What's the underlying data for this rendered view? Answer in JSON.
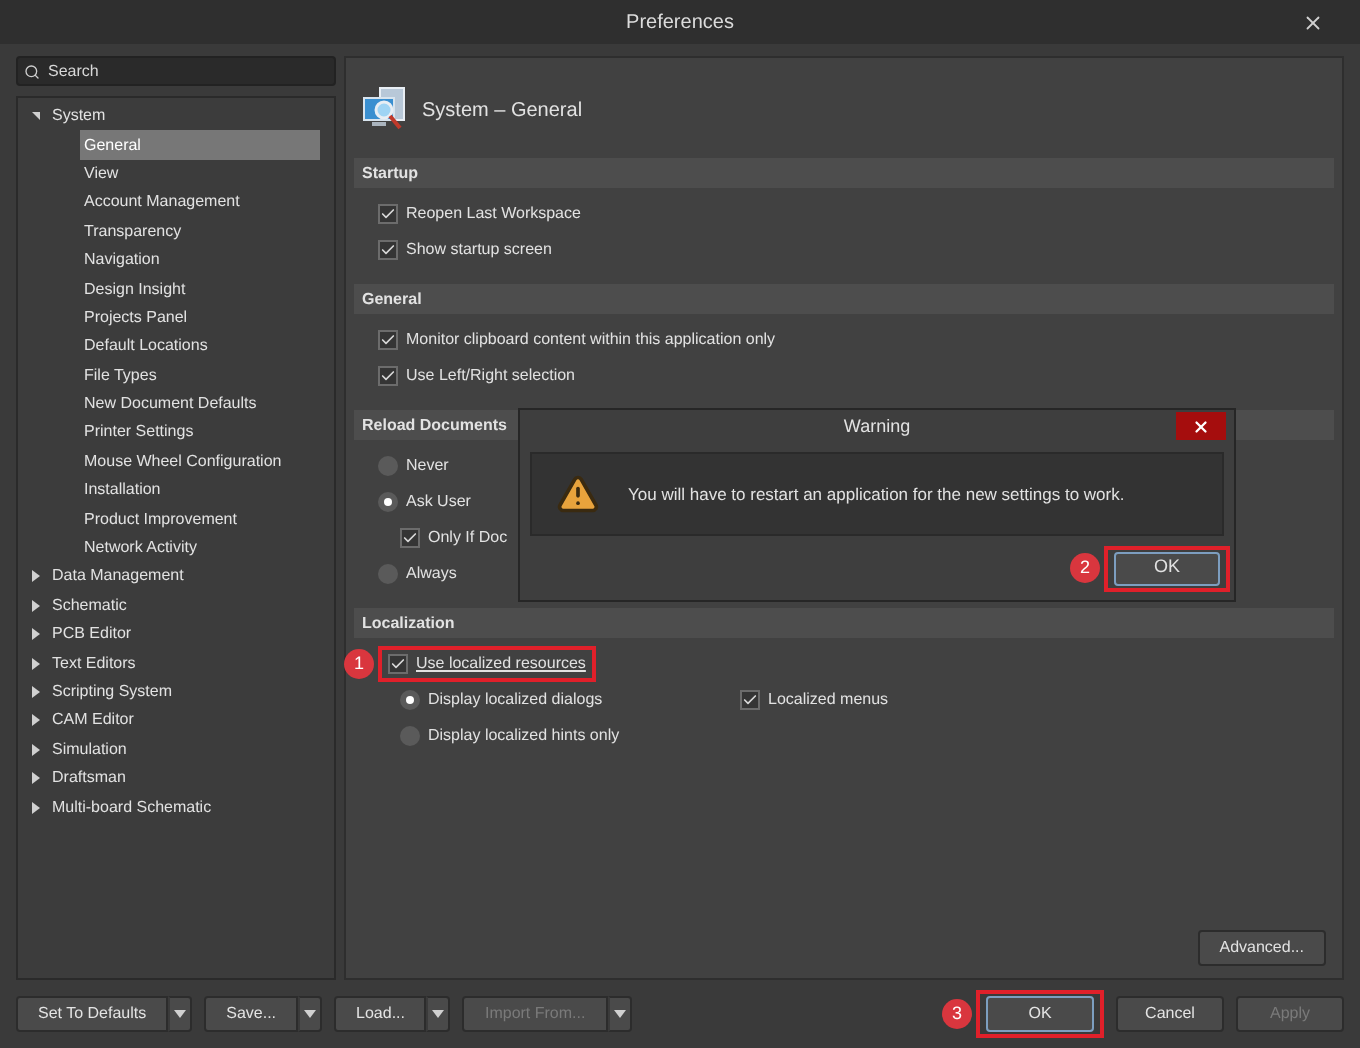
{
  "window": {
    "title": "Preferences"
  },
  "search": {
    "placeholder": "Search"
  },
  "tree": [
    {
      "label": "System",
      "expanded": true,
      "children": [
        {
          "label": "General",
          "selected": true
        },
        {
          "label": "View",
          "selected": false
        },
        {
          "label": "Account Management",
          "selected": false
        },
        {
          "label": "Transparency",
          "selected": false
        },
        {
          "label": "Navigation",
          "selected": false
        },
        {
          "label": "Design Insight",
          "selected": false
        },
        {
          "label": "Projects Panel",
          "selected": false
        },
        {
          "label": "Default Locations",
          "selected": false
        },
        {
          "label": "File Types",
          "selected": false
        },
        {
          "label": "New Document Defaults",
          "selected": false
        },
        {
          "label": "Printer Settings",
          "selected": false
        },
        {
          "label": "Mouse Wheel Configuration",
          "selected": false
        },
        {
          "label": "Installation",
          "selected": false
        },
        {
          "label": "Product Improvement",
          "selected": false
        },
        {
          "label": "Network Activity",
          "selected": false
        }
      ]
    },
    {
      "label": "Data Management",
      "expanded": false
    },
    {
      "label": "Schematic",
      "expanded": false
    },
    {
      "label": "PCB Editor",
      "expanded": false
    },
    {
      "label": "Text Editors",
      "expanded": false
    },
    {
      "label": "Scripting System",
      "expanded": false
    },
    {
      "label": "CAM Editor",
      "expanded": false
    },
    {
      "label": "Simulation",
      "expanded": false
    },
    {
      "label": "Draftsman",
      "expanded": false
    },
    {
      "label": "Multi-board Schematic",
      "expanded": false
    }
  ],
  "page": {
    "title": "System – General",
    "sections": [
      {
        "title": "Startup",
        "options": [
          {
            "kind": "checkbox",
            "label": "Reopen Last Workspace",
            "checked": true
          },
          {
            "kind": "checkbox",
            "label": "Show startup screen",
            "checked": true
          }
        ]
      },
      {
        "title": "General",
        "options": [
          {
            "kind": "checkbox",
            "label": "Monitor clipboard content within this application only",
            "checked": true
          },
          {
            "kind": "checkbox",
            "label": "Use Left/Right selection",
            "checked": true
          }
        ]
      },
      {
        "title": "Reload Documents",
        "options": [
          {
            "kind": "radio",
            "label": "Never",
            "selected": false
          },
          {
            "kind": "radio",
            "label": "Ask User",
            "selected": true,
            "children": [
              {
                "kind": "checkbox",
                "label": "Only If Doc",
                "checked": true
              }
            ]
          },
          {
            "kind": "radio",
            "label": "Always",
            "selected": false
          }
        ]
      },
      {
        "title": "Localization",
        "options": [
          {
            "kind": "checkbox",
            "label": "Use localized resources",
            "checked": true,
            "marker": "1",
            "children": [
              {
                "kind": "radio",
                "label": "Display localized dialogs",
                "selected": true,
                "companion": {
                  "kind": "checkbox",
                  "label": "Localized menus",
                  "checked": true
                }
              },
              {
                "kind": "radio",
                "label": "Display localized hints only",
                "selected": false
              }
            ]
          }
        ]
      }
    ],
    "advanced_button": "Advanced..."
  },
  "dialog": {
    "title": "Warning",
    "message": "You will have to restart an application for the new settings to work.",
    "button": {
      "label": "OK",
      "marker": "2"
    }
  },
  "footer": {
    "left": [
      {
        "label": "Set To Defaults",
        "disabled": false
      },
      {
        "label": "Save...",
        "disabled": false
      },
      {
        "label": "Load...",
        "disabled": false
      },
      {
        "label": "Import From...",
        "disabled": true
      }
    ],
    "right": [
      {
        "label": "OK",
        "disabled": false,
        "focused": true,
        "marker": "3"
      },
      {
        "label": "Cancel",
        "disabled": false,
        "focused": false
      },
      {
        "label": "Apply",
        "disabled": true,
        "focused": false
      }
    ]
  }
}
